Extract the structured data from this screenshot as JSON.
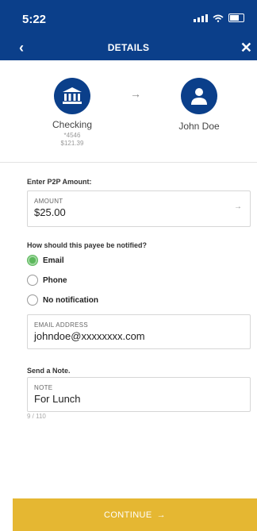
{
  "status_bar": {
    "time": "5:22"
  },
  "nav": {
    "title": "DETAILS",
    "back_icon": "chevron-left-icon",
    "close_icon": "close-icon"
  },
  "from_account": {
    "name": "Checking",
    "number": "*4546",
    "balance": "$121.39",
    "icon": "bank-icon"
  },
  "to_payee": {
    "name": "John Doe",
    "icon": "person-icon"
  },
  "amount_section": {
    "label": "Enter P2P Amount:",
    "field_caption": "AMOUNT",
    "value": "$25.00"
  },
  "notify_section": {
    "label": "How should this payee be notified?",
    "options": [
      {
        "label": "Email",
        "selected": true
      },
      {
        "label": "Phone",
        "selected": false
      },
      {
        "label": "No notification",
        "selected": false
      }
    ]
  },
  "email_field": {
    "caption": "EMAIL ADDRESS",
    "value": "johndoe@xxxxxxxx.com"
  },
  "note_section": {
    "label": "Send a Note.",
    "field_caption": "NOTE",
    "value": "For Lunch",
    "counter": "9 / 110"
  },
  "continue_button": {
    "label": "CONTINUE"
  },
  "colors": {
    "primary": "#0b3f8a",
    "accent": "#e5b732",
    "selected": "#5cb85c"
  }
}
